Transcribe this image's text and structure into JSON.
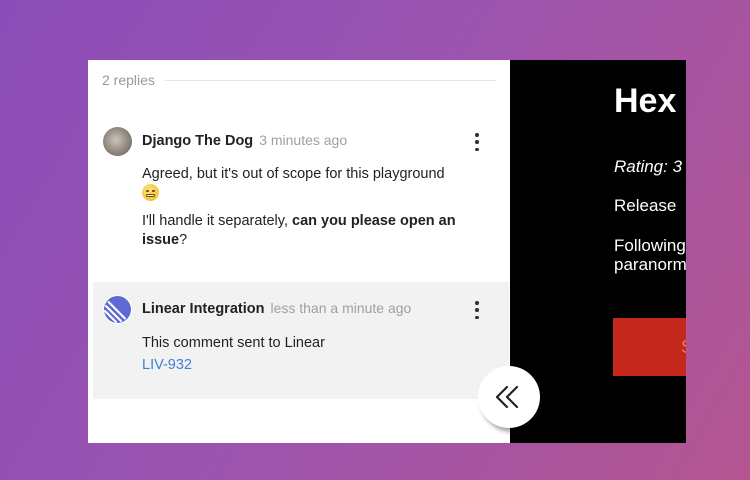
{
  "thread": {
    "replies_label": "2 replies"
  },
  "comments": [
    {
      "author": "Django The Dog",
      "time": "3 minutes ago",
      "text_line1": "Agreed, but it's out of scope for this playground",
      "text_line2_prefix": "I'll handle it separately, ",
      "text_line2_bold": "can you please open an issue",
      "text_line2_suffix": "?",
      "avatar_icon": "dog-photo-avatar",
      "emoji_icon": "grimacing-face-emoji"
    },
    {
      "author": "Linear Integration",
      "time": "less than a minute ago",
      "text": "This comment sent to Linear",
      "link": "LIV-932",
      "avatar_icon": "linear-logo-avatar"
    }
  ],
  "dark_pane": {
    "title": "Hex",
    "rating": "Rating: 3",
    "release": "Release",
    "following_line1": "Following",
    "following_line2": "paranorm",
    "button_label": "S"
  },
  "controls": {
    "collapse_icon": "double-chevron-left-icon",
    "more_icon": "vertical-ellipsis-icon"
  },
  "colors": {
    "background_start": "#8b4db8",
    "background_end": "#b45590",
    "link": "#3d7fd6",
    "highlight_comment_bg": "#f2f2f2",
    "red_button": "#c4271c"
  }
}
